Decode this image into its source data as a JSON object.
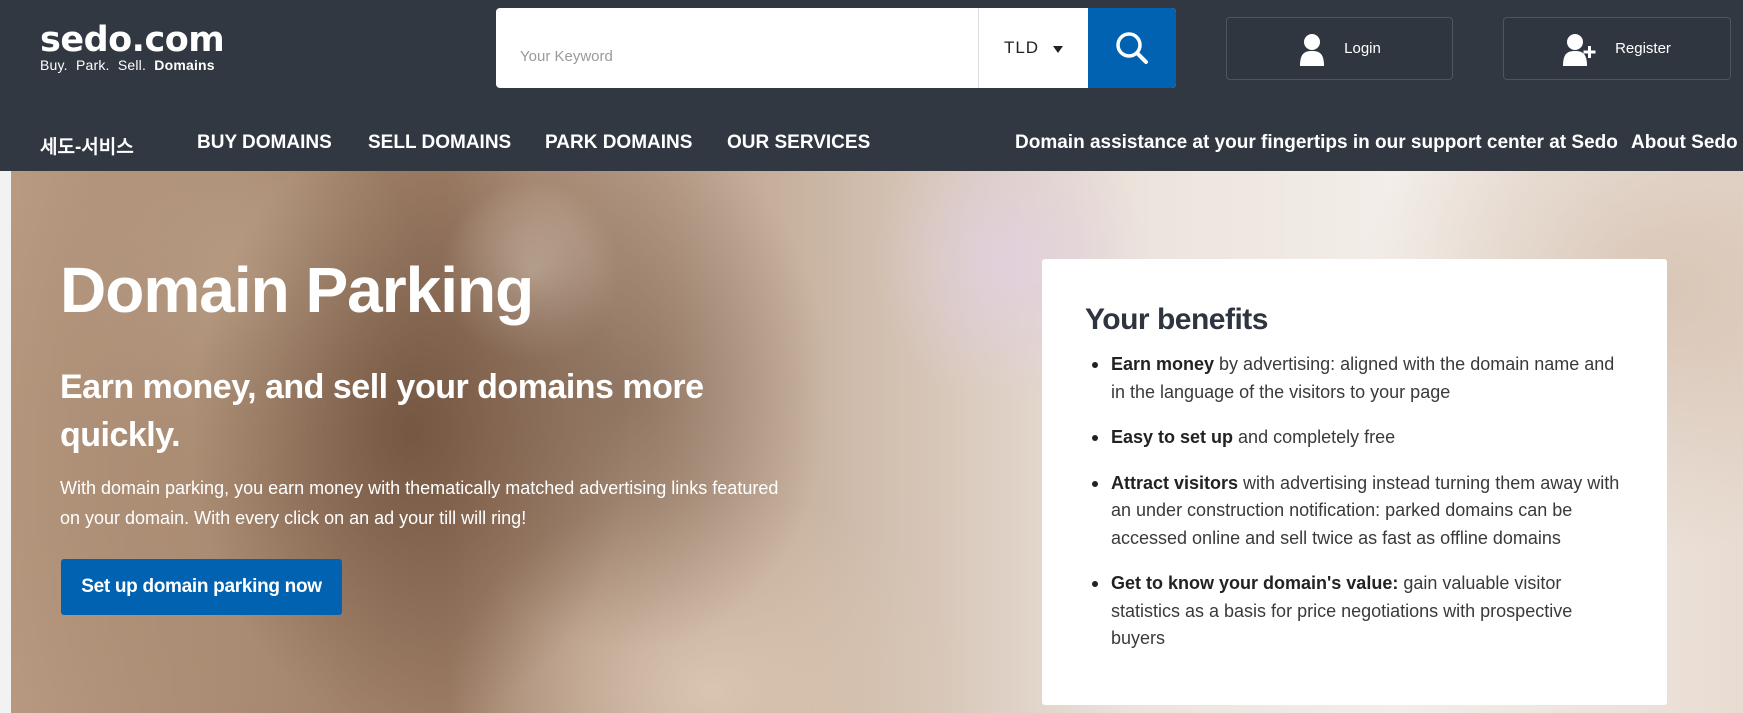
{
  "header": {
    "logo_main": "sedo.com",
    "logo_tagline": {
      "buy": "Buy.",
      "park": "Park.",
      "sell": "Sell.",
      "domains": "Domains"
    },
    "search": {
      "placeholder": "Your Keyword",
      "value": "",
      "tld_label": "TLD",
      "button_icon": "search-icon"
    },
    "login_label": "Login",
    "register_label": "Register"
  },
  "nav": {
    "items": [
      {
        "label": "세도-서비스"
      },
      {
        "label": "BUY DOMAINS"
      },
      {
        "label": "SELL DOMAINS"
      },
      {
        "label": "PARK DOMAINS"
      },
      {
        "label": "OUR SERVICES"
      },
      {
        "label": "Domain assistance at your fingertips in our support center at Sedo"
      },
      {
        "label": "About Sedo"
      }
    ]
  },
  "hero": {
    "title": "Domain Parking",
    "subtitle": "Earn money, and sell your domains more quickly.",
    "text": "With domain parking, you earn money with thematically matched advertising links featured on your domain. With every click on an ad your till will ring!",
    "cta_label": "Set up domain parking now"
  },
  "benefits": {
    "title": "Your benefits",
    "items": [
      {
        "bold": "Earn money",
        "text": " by advertising: aligned with the domain name and in the language of the visitors to your page"
      },
      {
        "bold": "Easy to set up",
        "text": " and completely free"
      },
      {
        "bold": "Attract visitors",
        "text": " with advertising instead turning them away with an under construction notification: parked domains can be accessed online and sell twice as fast as offline domains"
      },
      {
        "bold": "Get to know your domain's value:",
        "text": " gain valuable visitor statistics as a basis for price negotiations with prospective buyers"
      }
    ]
  },
  "colors": {
    "header_bg": "#313842",
    "accent": "#0062b1",
    "panel_bg": "#ffffff"
  }
}
